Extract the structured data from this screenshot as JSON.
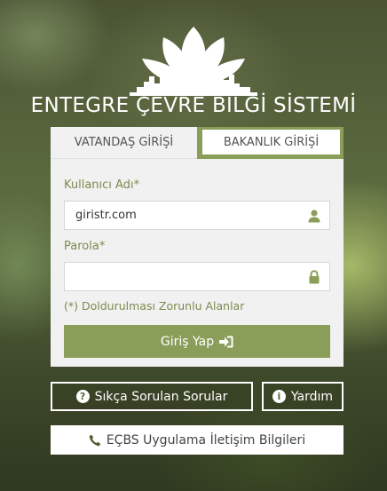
{
  "app": {
    "title": "ENTEGRE ÇEVRE BİLGİ SİSTEMİ"
  },
  "tabs": {
    "citizen": "VATANDAŞ GİRİŞİ",
    "ministry": "BAKANLIK GİRİŞİ",
    "active": "ministry"
  },
  "form": {
    "username_label": "Kullanıcı Adı*",
    "username_value": "giristr.com",
    "username_icon": "user-icon",
    "password_label": "Parola*",
    "password_value": "",
    "password_icon": "lock-icon",
    "required_hint": "(*) Doldurulması Zorunlu Alanlar",
    "login_label": "Giriş Yap",
    "login_icon": "sign-in-icon"
  },
  "links": {
    "faq_label": "Sıkça Sorulan Sorular",
    "faq_icon": "question-circle-icon",
    "help_label": "Yardım",
    "help_icon": "info-circle-icon",
    "contact_label": "EÇBS Uygulama İletişim Bilgileri",
    "contact_icon": "phone-icon"
  },
  "colors": {
    "accent": "#8a9e5a",
    "label": "#7b8b50",
    "panel": "#f1f1f1"
  }
}
